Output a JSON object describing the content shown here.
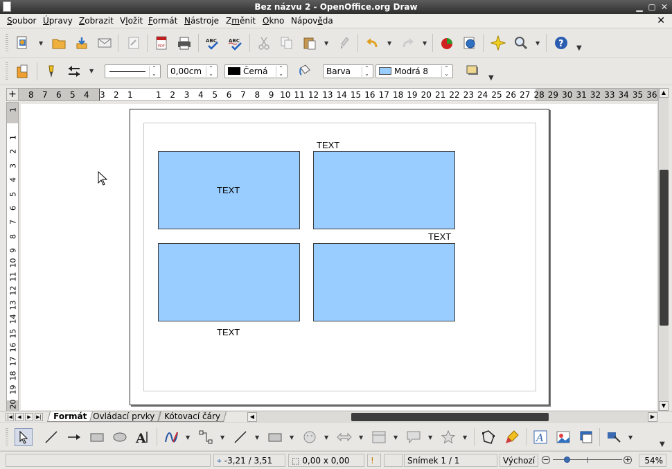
{
  "window": {
    "title": "Bez názvu 2 - OpenOffice.org Draw"
  },
  "menu": [
    {
      "label": "Soubor",
      "ul": "S",
      "rest": "oubor"
    },
    {
      "label": "Úpravy",
      "ul": "Ú",
      "rest": "pravy"
    },
    {
      "label": "Zobrazit",
      "ul": "Z",
      "rest": "obrazit"
    },
    {
      "label": "Vložit",
      "pre": "V",
      "ul": "l",
      "rest": "ožit"
    },
    {
      "label": "Formát",
      "ul": "F",
      "rest": "ormát"
    },
    {
      "label": "Nástroje",
      "ul": "N",
      "rest": "ástroje"
    },
    {
      "label": "Změnit",
      "pre": "Z",
      "ul": "m",
      "rest": "ěnit"
    },
    {
      "label": "Okno",
      "ul": "O",
      "rest": "kno"
    },
    {
      "label": "Nápověda",
      "pre": "Nápov",
      "ul": "ě",
      "rest": "da"
    }
  ],
  "line_toolbar": {
    "line_width": "0,00cm",
    "line_color": "Černá",
    "area_style": "Barva",
    "area_color": "Modrá 8",
    "line_color_hex": "#000000",
    "area_color_hex": "#99ccff"
  },
  "ruler": {
    "h_left": [
      "8",
      "7",
      "6",
      "5",
      "4",
      "3",
      "2",
      "1"
    ],
    "h_right": [
      "1",
      "2",
      "3",
      "4",
      "5",
      "6",
      "7",
      "8",
      "9",
      "10",
      "11",
      "12",
      "13",
      "14",
      "15",
      "16",
      "17",
      "18",
      "19",
      "20",
      "21",
      "22",
      "23",
      "24",
      "25",
      "26",
      "27",
      "28",
      "29",
      "30",
      "31",
      "32",
      "33",
      "34",
      "35",
      "36"
    ],
    "v_top": [
      "1"
    ],
    "v_main": [
      "1",
      "2",
      "3",
      "4",
      "5",
      "6",
      "7",
      "8",
      "9",
      "10",
      "11",
      "12",
      "13",
      "14",
      "15",
      "16",
      "17",
      "18",
      "19",
      "20"
    ]
  },
  "canvas": {
    "text_labels": [
      "TEXT",
      "TEXT",
      "TEXT",
      "TEXT"
    ],
    "shape_fill": "#99ccff"
  },
  "tabs": [
    "Formát",
    "Ovládací prvky",
    "Kótovací čáry"
  ],
  "status": {
    "position": "-3,21 / 3,51",
    "size": "0,00 x 0,00",
    "slide": "Snímek 1 / 1",
    "layout": "Výchozí",
    "zoom": "54%",
    "zoom_level": 54
  }
}
